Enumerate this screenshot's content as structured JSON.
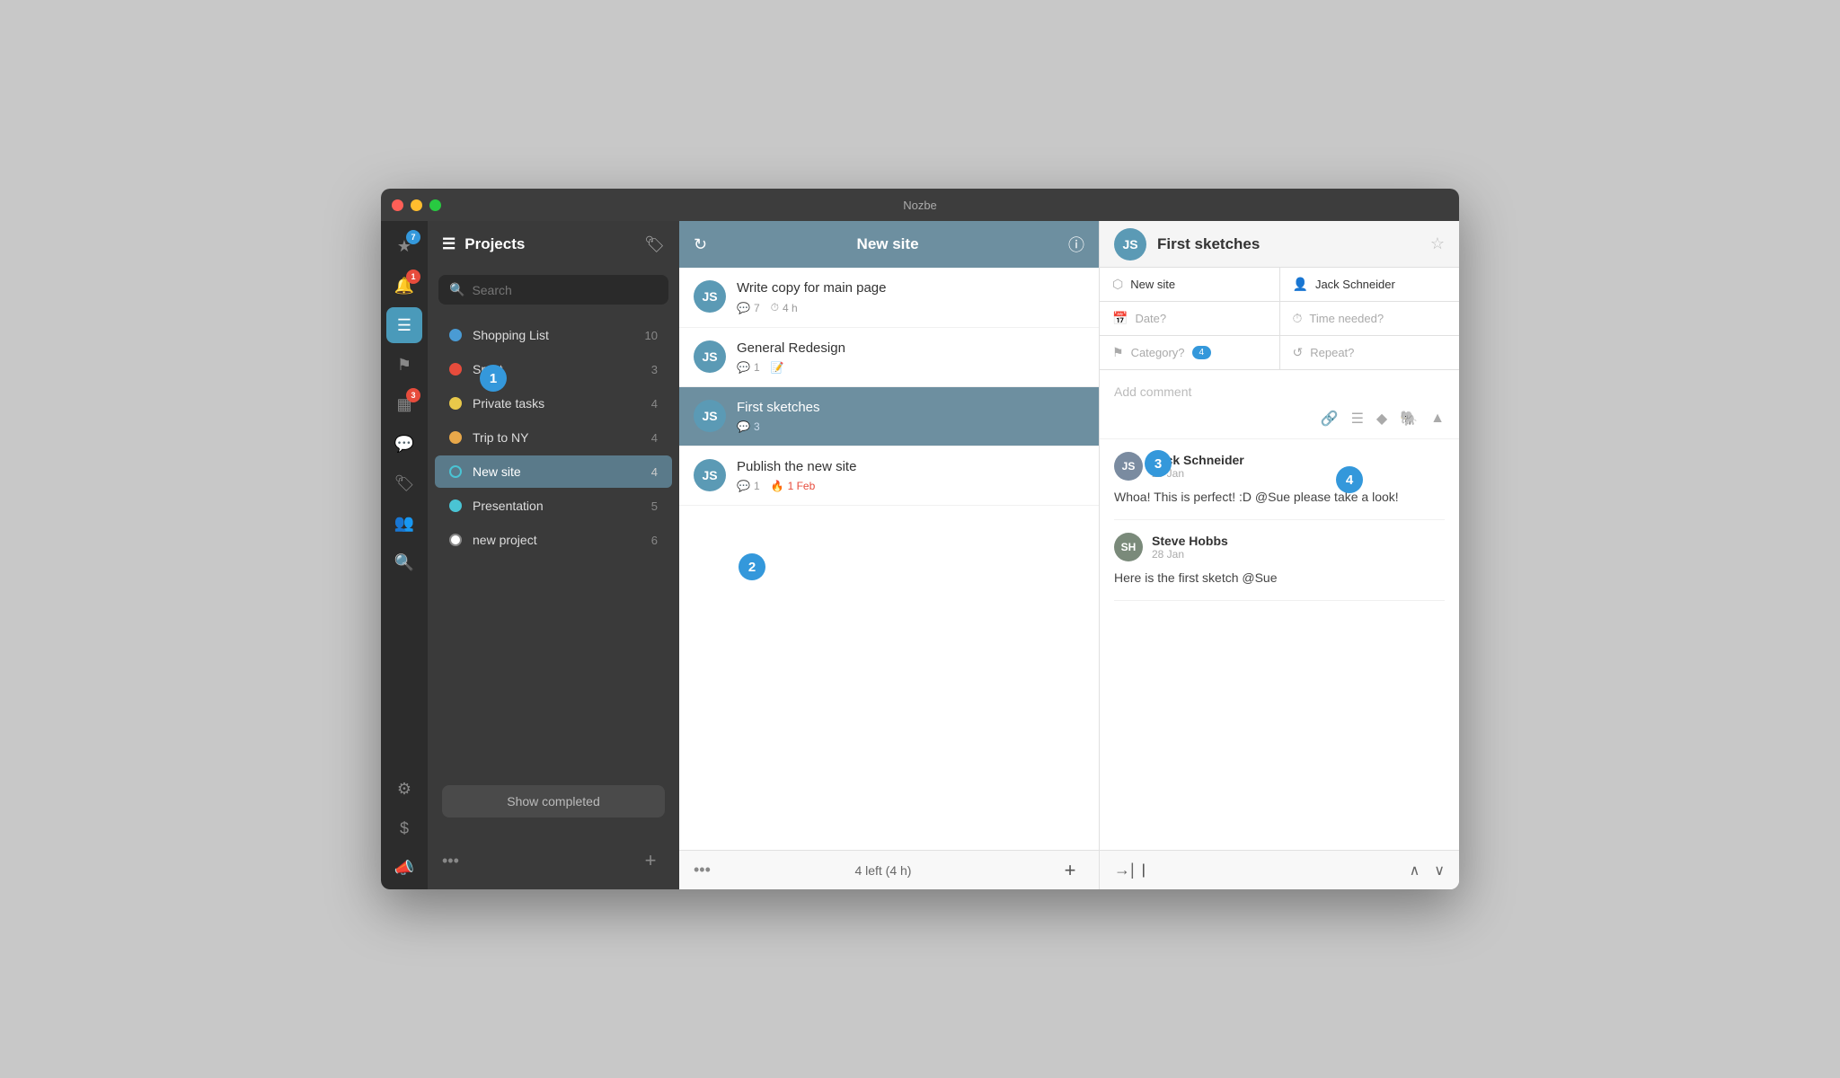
{
  "app": {
    "title": "Nozbe"
  },
  "icon_sidebar": {
    "items": [
      {
        "id": "priority",
        "icon": "★",
        "badge": "7",
        "badge_type": "blue",
        "tooltip": "Priority"
      },
      {
        "id": "inbox",
        "icon": "🔔",
        "badge": "1",
        "badge_type": "red",
        "tooltip": "Inbox"
      },
      {
        "id": "projects",
        "icon": "≡",
        "highlighted": true,
        "tooltip": "Projects"
      },
      {
        "id": "flags",
        "icon": "⚑",
        "tooltip": "Flags"
      },
      {
        "id": "calendar",
        "icon": "📅",
        "badge": "3",
        "badge_type": "red",
        "tooltip": "Calendar"
      },
      {
        "id": "chat",
        "icon": "💬",
        "tooltip": "Chat"
      },
      {
        "id": "tags",
        "icon": "🏷",
        "tooltip": "Tags"
      },
      {
        "id": "team",
        "icon": "👥",
        "tooltip": "Team"
      },
      {
        "id": "search",
        "icon": "🔍",
        "tooltip": "Search"
      },
      {
        "id": "settings",
        "icon": "⚙",
        "tooltip": "Settings"
      },
      {
        "id": "billing",
        "icon": "$",
        "tooltip": "Billing"
      },
      {
        "id": "announce",
        "icon": "📣",
        "tooltip": "Announcements"
      }
    ]
  },
  "projects_panel": {
    "header": {
      "title": "Projects",
      "icon": "≡"
    },
    "search": {
      "placeholder": "Search"
    },
    "items": [
      {
        "id": "shopping",
        "name": "Shopping List",
        "color": "#4a9bd4",
        "count": 10,
        "active": false
      },
      {
        "id": "sport",
        "name": "Sport",
        "color": "#e74c3c",
        "count": 3,
        "active": false
      },
      {
        "id": "private",
        "name": "Private tasks",
        "color": "#e8c84a",
        "count": 4,
        "active": false
      },
      {
        "id": "tripny",
        "name": "Trip to NY",
        "color": "#e8a84a",
        "count": 4,
        "active": false
      },
      {
        "id": "newsite",
        "name": "New site",
        "color": "#4a9bd4",
        "count": 4,
        "active": true
      },
      {
        "id": "presentation",
        "name": "Presentation",
        "color": "#4ac4d4",
        "count": 5,
        "active": false
      },
      {
        "id": "newproject",
        "name": "new project",
        "color": "#ffffff",
        "count": 6,
        "active": false
      }
    ],
    "show_completed_btn": "Show completed",
    "footer_add": "+",
    "footer_dots": "•••"
  },
  "tasks_panel": {
    "header": {
      "title": "New site",
      "sync_icon": "↻",
      "info_icon": "ⓘ"
    },
    "tasks": [
      {
        "id": "write-copy",
        "title": "Write copy for main page",
        "avatar_initials": "JS",
        "meta": [
          {
            "icon": "💬",
            "value": "7"
          },
          {
            "icon": "⏱",
            "value": "4 h"
          }
        ],
        "active": false
      },
      {
        "id": "general-redesign",
        "title": "General Redesign",
        "avatar_initials": "JS",
        "meta": [
          {
            "icon": "💬",
            "value": "1"
          },
          {
            "icon": "📝",
            "value": ""
          }
        ],
        "active": false
      },
      {
        "id": "first-sketches",
        "title": "First sketches",
        "avatar_initials": "JS",
        "meta": [
          {
            "icon": "💬",
            "value": "3"
          }
        ],
        "active": true
      },
      {
        "id": "publish",
        "title": "Publish the new site",
        "avatar_initials": "JS",
        "meta": [
          {
            "icon": "💬",
            "value": "1"
          },
          {
            "icon": "🔥",
            "value": "1 Feb",
            "fire": true
          }
        ],
        "active": false
      }
    ],
    "footer": {
      "dots": "•••",
      "count": "4 left (4 h)",
      "add": "+"
    }
  },
  "detail_panel": {
    "task_title": "First sketches",
    "avatar_initials": "JS",
    "fields": {
      "project": "New site",
      "assignee": "Jack Schneider",
      "date": "Date?",
      "time": "Time needed?",
      "category": "Category?",
      "repeat": "Repeat?"
    },
    "comment_placeholder": "Add comment",
    "comments": [
      {
        "id": "comment-1",
        "author": "Jack Schneider",
        "date": "29 Jan",
        "avatar_initials": "JS",
        "text": "Whoa! This is perfect! :D @Sue please take a look!"
      },
      {
        "id": "comment-2",
        "author": "Steve Hobbs",
        "date": "28 Jan",
        "avatar_initials": "SH",
        "text": "Here is the first sketch @Sue"
      }
    ],
    "footer": {
      "indent_icon": "→|",
      "up_icon": "∧",
      "down_icon": "∨"
    }
  },
  "tutorial_badges": [
    {
      "id": "badge-1",
      "label": "1"
    },
    {
      "id": "badge-2",
      "label": "2"
    },
    {
      "id": "badge-3",
      "label": "3"
    },
    {
      "id": "badge-4",
      "label": "4"
    }
  ]
}
